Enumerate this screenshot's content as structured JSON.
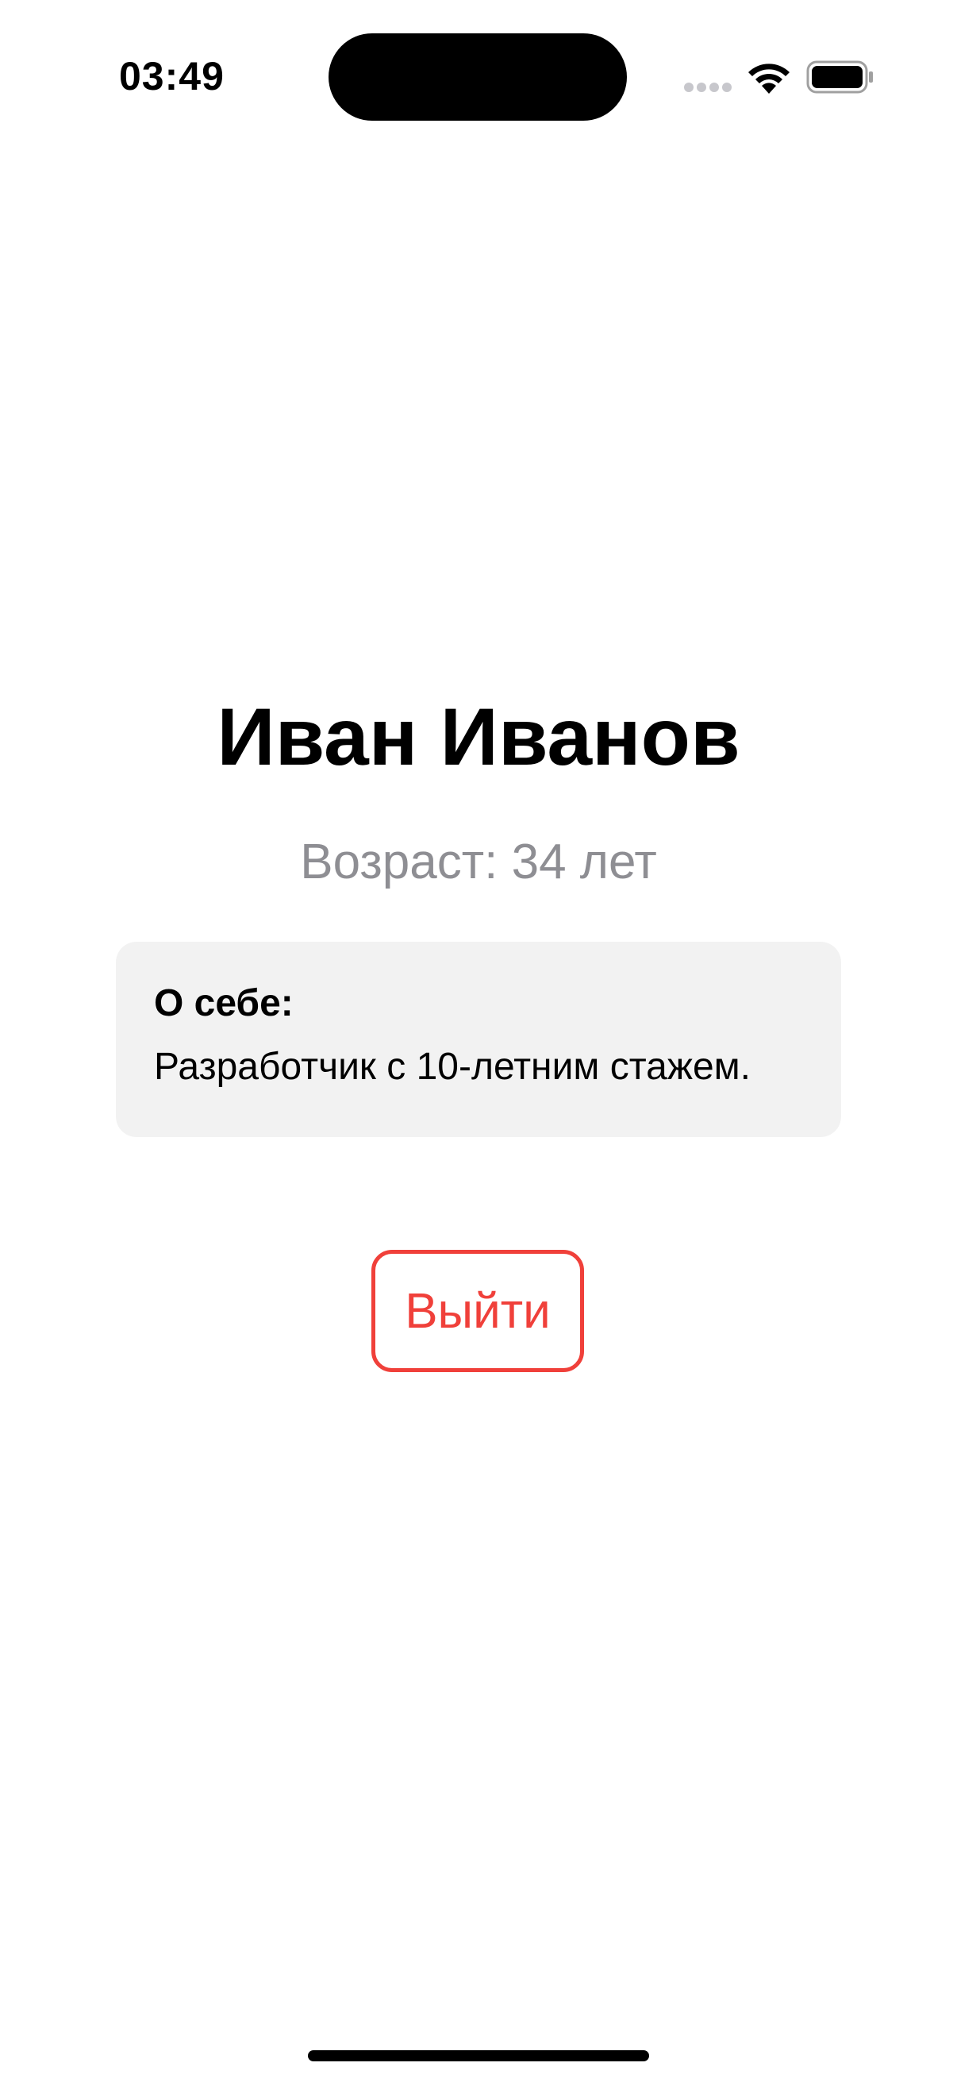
{
  "status_bar": {
    "time": "03:49",
    "icons": {
      "signal": "cellular-signal-icon",
      "wifi": "wifi-icon",
      "battery": "battery-icon"
    }
  },
  "profile": {
    "name": "Иван Иванов",
    "age_text": "Возраст: 34 лет",
    "about": {
      "title": "О себе:",
      "text": "Разработчик с 10-летним стажем."
    }
  },
  "actions": {
    "logout_label": "Выйти"
  },
  "colors": {
    "accent_red": "#f0403a",
    "secondary_text": "#8e8e93",
    "card_background": "#f2f2f2"
  }
}
